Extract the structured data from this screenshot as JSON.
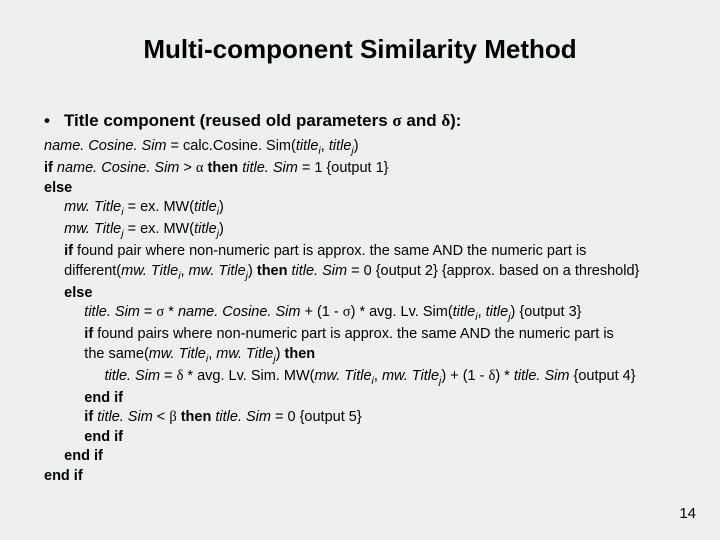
{
  "title": "Multi-component Similarity Method",
  "bullet": {
    "prefix": "Title component (reused old parameters ",
    "sym1": "σ",
    "mid": "  and ",
    "sym2": "δ",
    "suffix": "):"
  },
  "l1a": "name. Cosine. Sim",
  "l1b": " = calc.Cosine. Sim(",
  "l1c": "title",
  "l1d": ", ",
  "l1e": "title",
  "l1f": ")",
  "l2a": "if ",
  "l2b": "name. Cosine. Sim",
  "l2c": " > ",
  "l2alpha": "α",
  "l2d": " then ",
  "l2e": "title. Sim",
  "l2f": " = 1 {output 1}",
  "l3a": "else",
  "l4a": "mw. Title",
  "l4b": " = ex. MW(",
  "l4c": "title",
  "l4d": ")",
  "l5a": "mw. Title",
  "l5b": " = ex. MW(",
  "l5c": "title",
  "l5d": ")",
  "l6a": "if ",
  "l6b": "found pair where non-numeric part is approx. the same AND the numeric part is",
  "l7a": "different(",
  "l7b": "mw. Title",
  "l7c": ", ",
  "l7d": "mw. Title",
  "l7e": ") ",
  "l7f": "then ",
  "l7g": "title. Sim",
  "l7h": " = 0 {output 2} {approx. based on a threshold}",
  "l8a": "else",
  "l9a": "title. Sim",
  "l9b": " = ",
  "l9sigma1": "σ",
  "l9c": " * ",
  "l9d": "name. Cosine. Sim",
  "l9e": " + (1 - ",
  "l9sigma2": "σ",
  "l9f": ") * avg. Lv. Sim(",
  "l9g": "title",
  "l9h": ", ",
  "l9i": "title",
  "l9j": ") {output 3}",
  "l10a": "if ",
  "l10b": "found pairs where non-numeric part is approx. the same AND the numeric part is",
  "l11a": "the same(",
  "l11b": "mw. Title",
  "l11c": ", ",
  "l11d": "mw. Title",
  "l11e": ") ",
  "l11f": "then",
  "l12a": "title. Sim",
  "l12b": " = ",
  "l12delta1": "δ",
  "l12c": " * avg. Lv. Sim. MW(",
  "l12d": "mw. Title",
  "l12e": ", ",
  "l12f": "mw. Title",
  "l12g": ") + (1 - ",
  "l12delta2": "δ",
  "l12h": ") * ",
  "l12i": "title. Sim",
  "l12j": " {output 4}",
  "l13a": "end if",
  "l14a": "if ",
  "l14b": "title. Sim",
  "l14c": " < ",
  "l14beta": "β",
  "l14d": " then ",
  "l14e": "title. Sim",
  "l14f": " = 0 {output 5}",
  "l15a": "end if",
  "l16a": "end if",
  "l17a": "end if",
  "sub_i": "i",
  "sub_j": "j",
  "pagenum": "14"
}
